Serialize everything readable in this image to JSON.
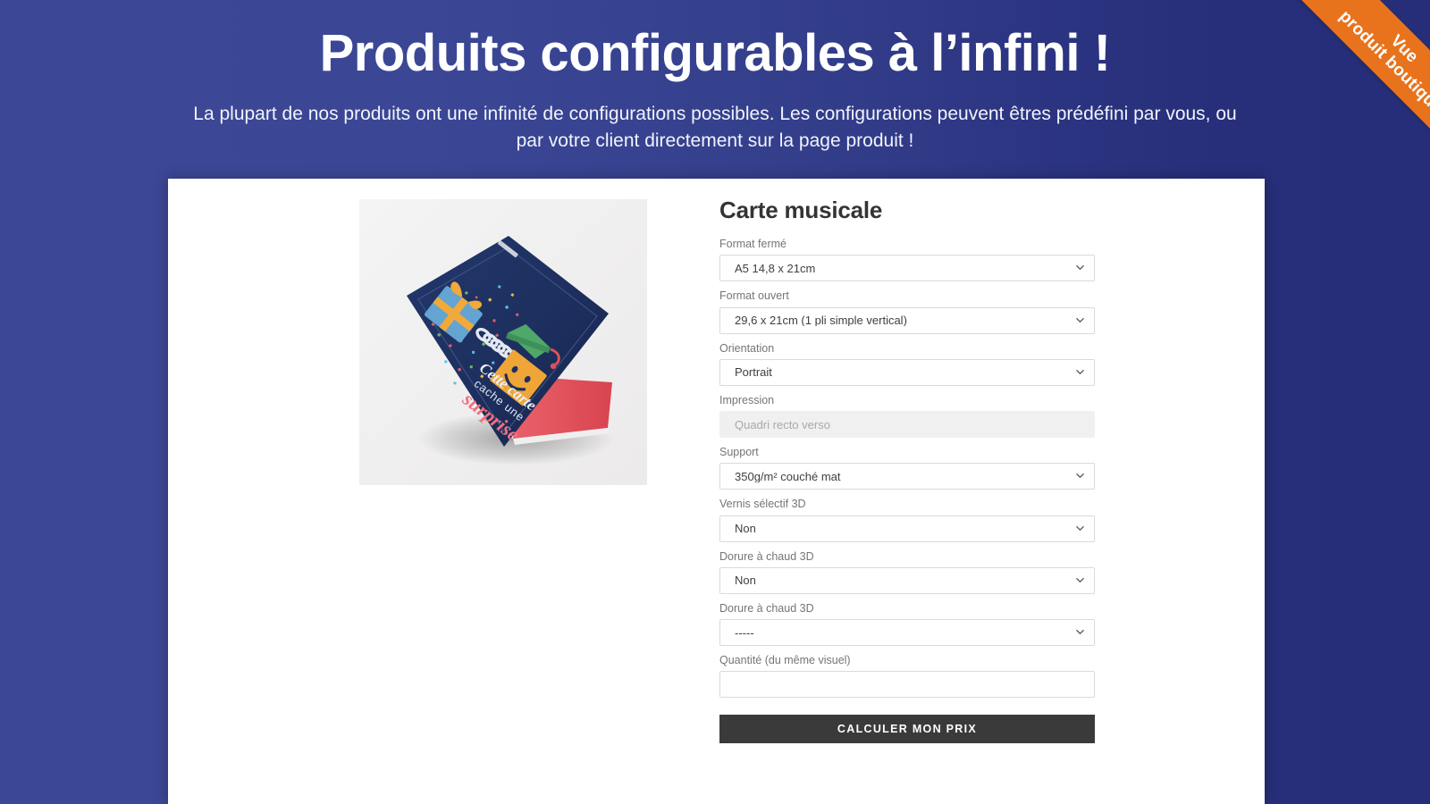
{
  "hero": {
    "title": "Produits configurables à l’infini !",
    "subtitle": "La plupart de nos produits ont une infinité de configurations possibles. Les configurations peuvent êtres prédéfini par vous, ou par votre client directement sur la page produit !"
  },
  "ribbon": {
    "line1": "Vue",
    "line2": "produit boutique",
    "color": "#e8731c"
  },
  "colors": {
    "background_left": "#3c4796",
    "background_right": "#262e79",
    "panel": "#ffffff",
    "button": "#3a3a3a",
    "label": "#757575",
    "value": "#3f3f3f",
    "media_background": "#f1f1f1"
  },
  "product": {
    "title": "Carte musicale",
    "media": {
      "alt": "Carte de voeux pliée bleu marine posée sur fond gris",
      "card_text_line1": "Cette carte",
      "card_text_line2": "cache une",
      "card_text_line3": "surprise",
      "card_color": "#1e3060",
      "inner_color": "#e2565c"
    },
    "fields": [
      {
        "name": "format-ferme",
        "label": "Format fermé",
        "type": "select",
        "value": "A5 14,8 x 21cm",
        "disabled": false
      },
      {
        "name": "format-ouvert",
        "label": "Format ouvert",
        "type": "select",
        "value": "29,6 x 21cm (1 pli simple vertical)",
        "disabled": false
      },
      {
        "name": "orientation",
        "label": "Orientation",
        "type": "select",
        "value": "Portrait",
        "disabled": false
      },
      {
        "name": "impression",
        "label": "Impression",
        "type": "readonly",
        "value": "Quadri recto verso",
        "disabled": true
      },
      {
        "name": "support",
        "label": "Support",
        "type": "select",
        "value": "350g/m² couché mat",
        "disabled": false
      },
      {
        "name": "vernis-selectif-3d",
        "label": "Vernis sélectif 3D",
        "type": "select",
        "value": "Non",
        "disabled": false
      },
      {
        "name": "dorure-a-chaud-3d-1",
        "label": "Dorure à chaud 3D",
        "type": "select",
        "value": "Non",
        "disabled": false
      },
      {
        "name": "dorure-a-chaud-3d-2",
        "label": "Dorure à chaud 3D",
        "type": "select",
        "value": "-----",
        "disabled": false
      },
      {
        "name": "quantite",
        "label": "Quantité (du même visuel)",
        "type": "text",
        "value": "",
        "placeholder": "",
        "disabled": false
      }
    ],
    "submit_label": "Calculer mon prix"
  }
}
